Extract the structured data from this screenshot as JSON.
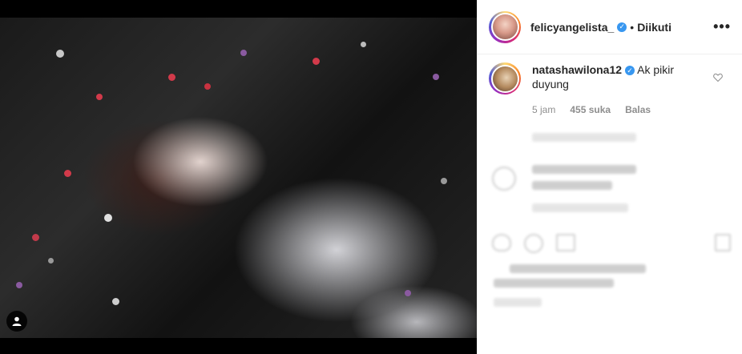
{
  "post": {
    "author": "felicyangelista_",
    "follow_status": "Diikuti",
    "separator": "•",
    "more_label": "•••"
  },
  "comment": {
    "username": "natashawilona12",
    "text": "Ak pikir duyung",
    "time": "5 jam",
    "likes": "455 suka",
    "reply_label": "Balas"
  },
  "icons": {
    "verified": "verified-badge-icon",
    "heart": "heart-icon",
    "profile_corner": "user-profile-icon"
  },
  "colors": {
    "verified": "#3897f0",
    "meta_text": "#8e8e8e",
    "primary_text": "#262626"
  }
}
